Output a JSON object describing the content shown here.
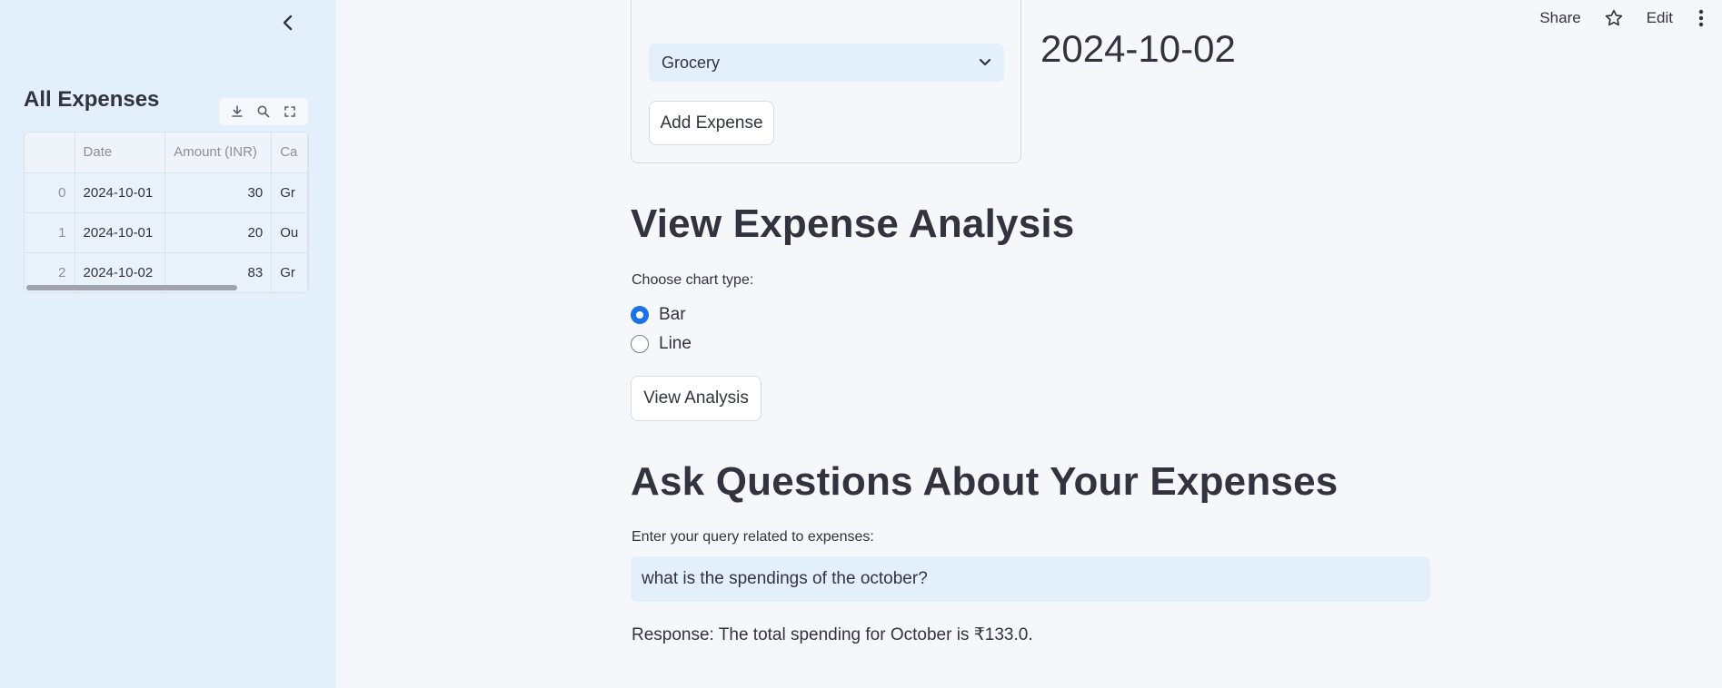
{
  "header": {
    "share_label": "Share",
    "edit_label": "Edit"
  },
  "sidebar": {
    "title": "All Expenses",
    "table": {
      "columns": [
        "",
        "Date",
        "Amount (INR)",
        "Ca"
      ],
      "rows": [
        {
          "idx": "0",
          "date": "2024-10-01",
          "amount": "30",
          "cat": "Gr"
        },
        {
          "idx": "1",
          "date": "2024-10-01",
          "amount": "20",
          "cat": "Ou"
        },
        {
          "idx": "2",
          "date": "2024-10-02",
          "amount": "83",
          "cat": "Gr"
        }
      ]
    }
  },
  "form": {
    "category_selected": "Grocery",
    "add_button": "Add Expense",
    "date_display": "2024-10-02"
  },
  "analysis": {
    "heading": "View Expense Analysis",
    "chart_type_label": "Choose chart type:",
    "options": [
      {
        "label": "Bar",
        "selected": true
      },
      {
        "label": "Line",
        "selected": false
      }
    ],
    "view_button": "View Analysis"
  },
  "questions": {
    "heading": "Ask Questions About Your Expenses",
    "query_label": "Enter your query related to expenses:",
    "query_value": "what is the spendings of the october?",
    "response": "Response: The total spending for October is ₹133.0."
  },
  "colors": {
    "accent": "#1a73e8",
    "sidebar_bg": "#e3f0fc",
    "page_bg": "#f5f7fa"
  }
}
